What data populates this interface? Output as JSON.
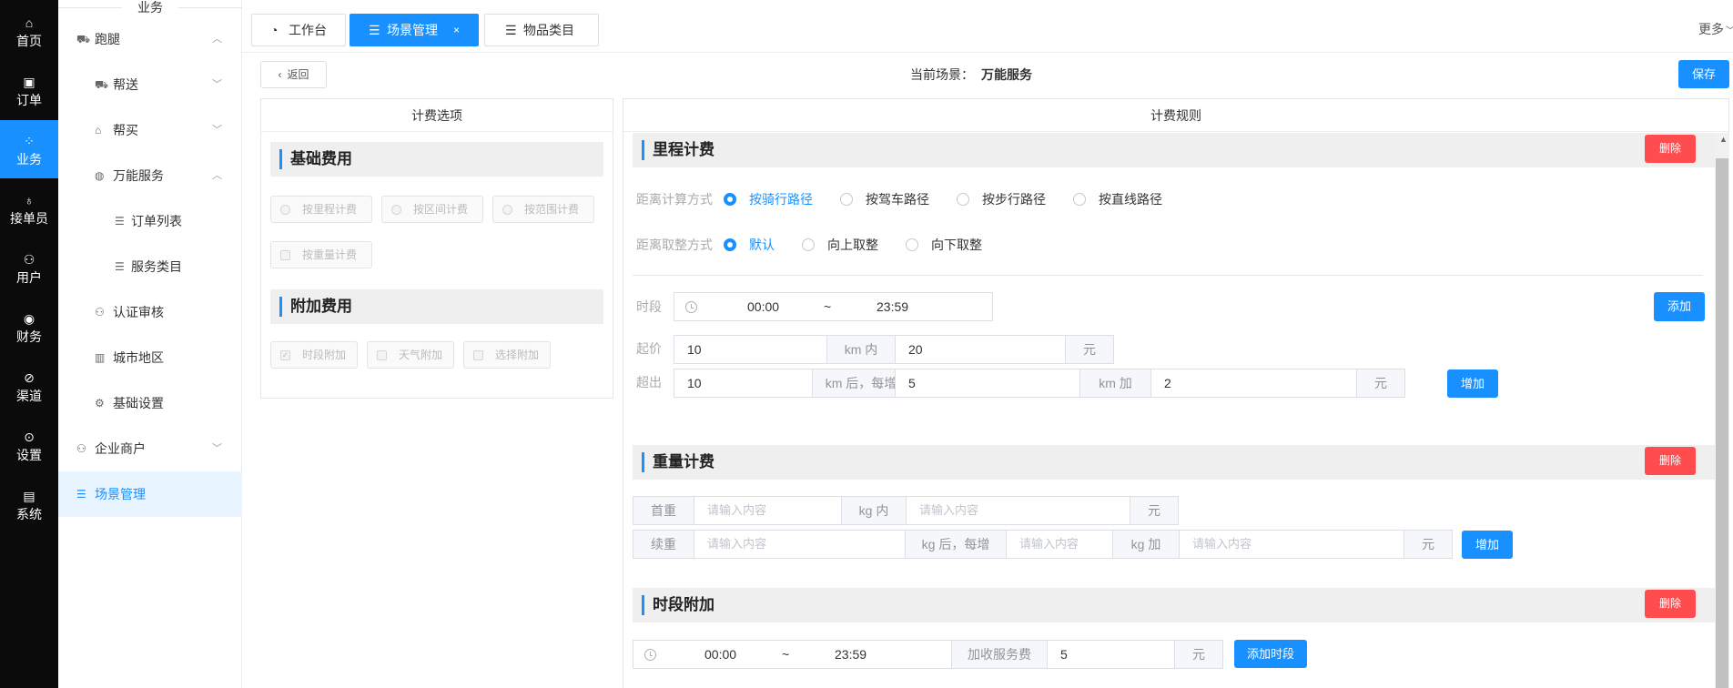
{
  "rail": {
    "items": [
      {
        "label": "首页",
        "icon": "home-icon",
        "glyph": "⌂"
      },
      {
        "label": "订单",
        "icon": "order-icon",
        "glyph": "▣"
      },
      {
        "label": "业务",
        "icon": "business-icon",
        "glyph": "⁘"
      },
      {
        "label": "接单员",
        "icon": "bike-icon",
        "glyph": "♁"
      },
      {
        "label": "用户",
        "icon": "user-icon",
        "glyph": "⚇"
      },
      {
        "label": "财务",
        "icon": "finance-icon",
        "glyph": "◉"
      },
      {
        "label": "渠道",
        "icon": "channel-icon",
        "glyph": "⊘"
      },
      {
        "label": "设置",
        "icon": "settings-icon",
        "glyph": "⊙"
      },
      {
        "label": "系统",
        "icon": "system-icon",
        "glyph": "▤"
      }
    ],
    "active_color": "#1890ff"
  },
  "sidebar": {
    "title": "业务",
    "items": [
      {
        "label": "跑腿",
        "icon": "errand-icon",
        "glyph": "⛟",
        "expanded": true
      },
      {
        "label": "帮送",
        "icon": "deliver-icon",
        "glyph": "⛟",
        "expanded": false
      },
      {
        "label": "帮买",
        "icon": "shop-icon",
        "glyph": "⌂",
        "expanded": false
      },
      {
        "label": "万能服务",
        "icon": "globe-icon",
        "glyph": "◍",
        "expanded": true
      },
      {
        "label": "订单列表",
        "icon": "list-icon",
        "glyph": "☰"
      },
      {
        "label": "服务类目",
        "icon": "list-icon",
        "glyph": "☰"
      },
      {
        "label": "认证审核",
        "icon": "user-check-icon",
        "glyph": "⚇"
      },
      {
        "label": "城市地区",
        "icon": "building-icon",
        "glyph": "▥"
      },
      {
        "label": "基础设置",
        "icon": "gear-icon",
        "glyph": "⚙"
      },
      {
        "label": "企业商户",
        "icon": "users-icon",
        "glyph": "⚇",
        "expanded": false
      },
      {
        "label": "场景管理",
        "icon": "list-icon",
        "glyph": "☰",
        "active": true
      }
    ]
  },
  "tabs": [
    {
      "label": "工作台",
      "icon": "dashboard-icon",
      "glyph": "◔"
    },
    {
      "label": "场景管理",
      "icon": "list-icon",
      "glyph": "☰",
      "close": "×"
    },
    {
      "label": "物品类目",
      "icon": "list-icon",
      "glyph": "☰"
    }
  ],
  "more_label": "更多",
  "header": {
    "back_label": "返回",
    "current_label": "当前场景：",
    "current_value": "万能服务",
    "save_label": "保存"
  },
  "left_panel": {
    "title": "计费选项",
    "basic_title": "基础费用",
    "basic_options": [
      "按里程计费",
      "按区间计费",
      "按范围计费",
      "按重量计费"
    ],
    "extra_title": "附加费用",
    "extra_options": [
      "时段附加",
      "天气附加",
      "选择附加"
    ],
    "extra_checked": "时段附加"
  },
  "right_panel": {
    "title": "计费规则",
    "delete_label": "删除",
    "mileage": {
      "title": "里程计费",
      "distance_method_label": "距离计算方式",
      "distance_methods": [
        "按骑行路径",
        "按驾车路径",
        "按步行路径",
        "按直线路径"
      ],
      "distance_method_selected": "按骑行路径",
      "rounding_label": "距离取整方式",
      "rounding_options": [
        "默认",
        "向上取整",
        "向下取整"
      ],
      "rounding_selected": "默认",
      "period_label": "时段",
      "period_start": "00:00",
      "period_sep": "~",
      "period_end": "23:59",
      "add_label": "添加",
      "start_label": "起价",
      "start_km": "10",
      "start_km_unit": "km 内",
      "start_price": "20",
      "yuan": "元",
      "over_label": "超出",
      "over_km": "10",
      "over_km_unit": "km 后，每增加",
      "over_step": "5",
      "over_step_unit": "km 加",
      "over_price": "2",
      "increase_label": "增加"
    },
    "weight": {
      "title": "重量计费",
      "first_label": "首重",
      "placeholder": "请输入内容",
      "first_unit": "kg 内",
      "yuan": "元",
      "extra_label": "续重",
      "extra_unit": "kg 后，每增",
      "add_unit": "kg 加",
      "increase_label": "增加"
    },
    "period_extra": {
      "title": "时段附加",
      "start": "00:00",
      "sep": "~",
      "end": "23:59",
      "fee_label": "加收服务费",
      "fee_value": "5",
      "yuan": "元",
      "add_period_label": "添加时段"
    }
  }
}
